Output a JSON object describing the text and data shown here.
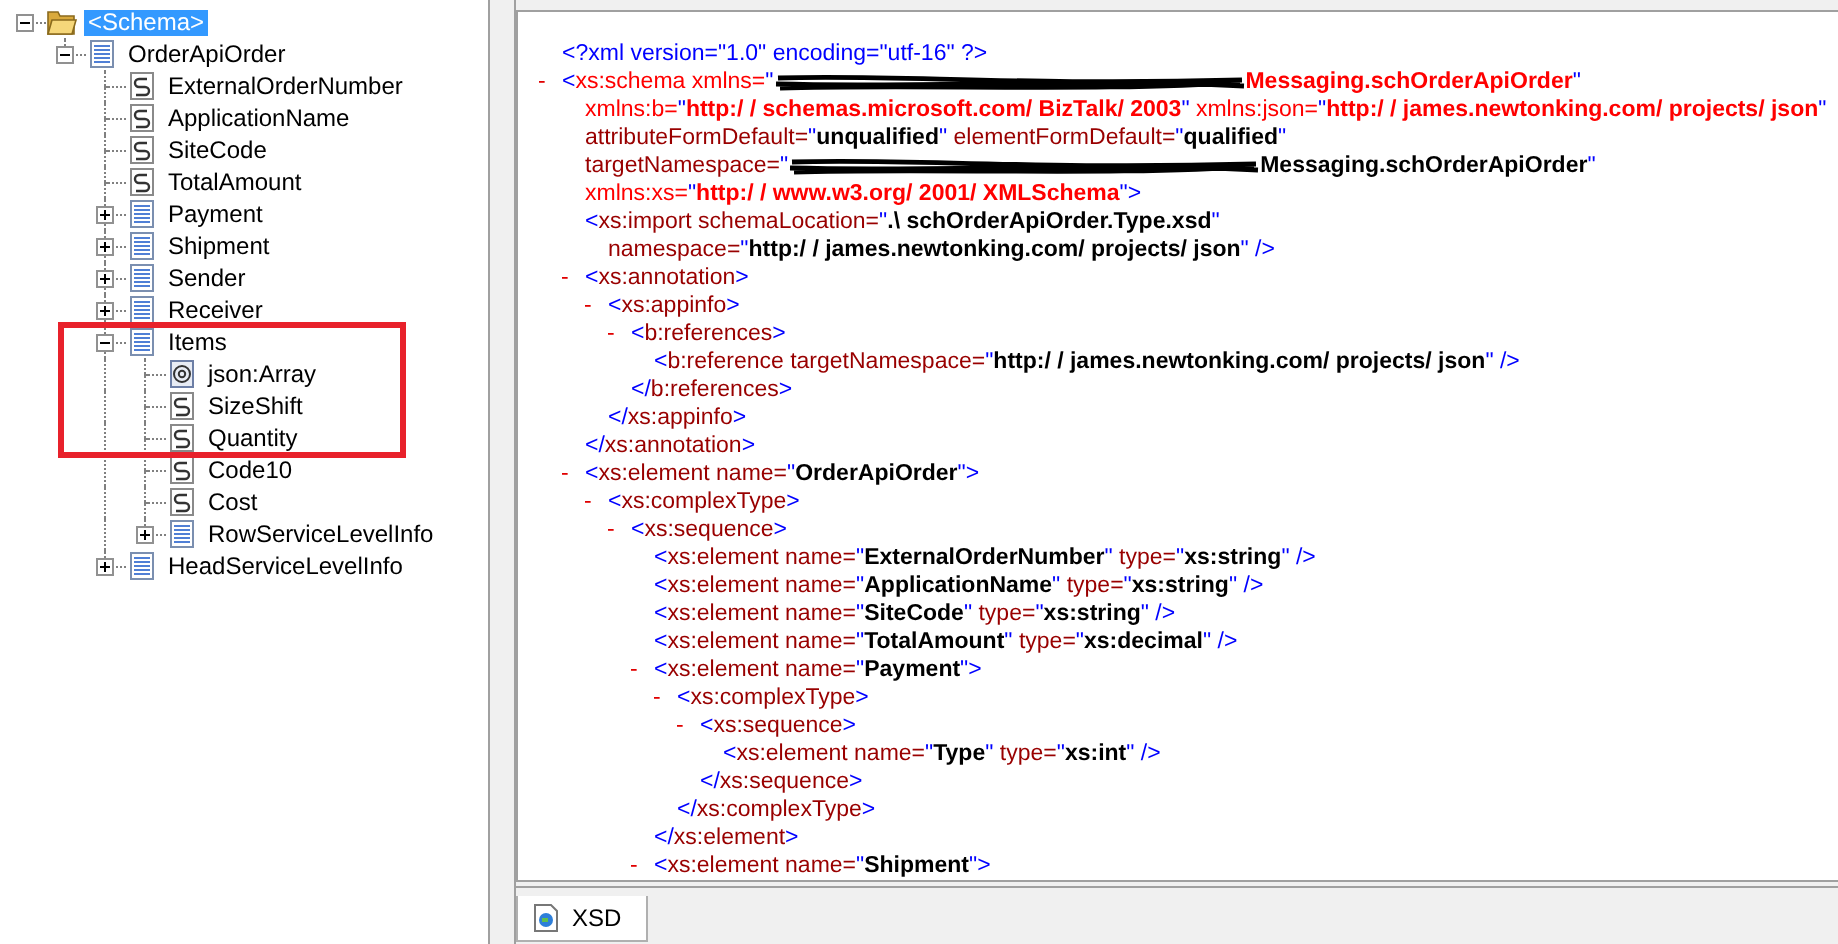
{
  "schema_tree": {
    "nodes": [
      {
        "label": "<Schema>",
        "kind": "folder",
        "expanded": true,
        "selected": true,
        "children": [
          {
            "label": "OrderApiOrder",
            "kind": "record",
            "expanded": true,
            "selected": false,
            "children": [
              {
                "label": "ExternalOrderNumber",
                "kind": "field",
                "selected": false
              },
              {
                "label": "ApplicationName",
                "kind": "field",
                "selected": false
              },
              {
                "label": "SiteCode",
                "kind": "field",
                "selected": false
              },
              {
                "label": "TotalAmount",
                "kind": "field",
                "selected": false
              },
              {
                "label": "Payment",
                "kind": "record",
                "expanded": false,
                "selected": false
              },
              {
                "label": "Shipment",
                "kind": "record",
                "expanded": false,
                "selected": false
              },
              {
                "label": "Sender",
                "kind": "record",
                "expanded": false,
                "selected": false
              },
              {
                "label": "Receiver",
                "kind": "record",
                "expanded": false,
                "selected": false
              },
              {
                "label": "Items",
                "kind": "record",
                "expanded": true,
                "selected": false,
                "children": [
                  {
                    "label": "json:Array",
                    "kind": "attribute",
                    "selected": false
                  },
                  {
                    "label": "SizeShift",
                    "kind": "field",
                    "selected": false
                  },
                  {
                    "label": "Quantity",
                    "kind": "field",
                    "selected": false
                  },
                  {
                    "label": "Code10",
                    "kind": "field",
                    "selected": false
                  },
                  {
                    "label": "Cost",
                    "kind": "field",
                    "selected": false
                  },
                  {
                    "label": "RowServiceLevelInfo",
                    "kind": "record",
                    "expanded": false,
                    "selected": false
                  }
                ]
              },
              {
                "label": "HeadServiceLevelInfo",
                "kind": "record",
                "expanded": false,
                "selected": false
              }
            ]
          }
        ]
      }
    ]
  },
  "xml_view": {
    "nodes": [
      {
        "lines": [
          [
            {
              "kind": "punct",
              "t": "<?xml version=\"1.0\" encoding=\"utf-16\" ?>"
            }
          ]
        ]
      },
      {
        "toggle": "-",
        "lines": [
          [
            {
              "kind": "punct",
              "t": "<"
            },
            {
              "kind": "namespace",
              "t": "xs:schema xmlns="
            },
            {
              "kind": "punct",
              "t": "\""
            },
            {
              "kind": "redacted"
            },
            {
              "kind": "namespace_value",
              "t": "Messaging.schOrderApiOrder"
            },
            {
              "kind": "punct",
              "t": "\""
            }
          ],
          [
            {
              "kind": "namespace",
              "t": "xmlns:b="
            },
            {
              "kind": "punct",
              "t": "\""
            },
            {
              "kind": "namespace_value",
              "t": "http:/ / schemas.microsoft.com/ BizTalk/ 2003"
            },
            {
              "kind": "punct",
              "t": "\""
            },
            {
              "kind": "namespace",
              "t": " xmlns:json="
            },
            {
              "kind": "punct",
              "t": "\""
            },
            {
              "kind": "namespace_value",
              "t": "http:/ / james.newtonking.com/ projects/ json"
            },
            {
              "kind": "punct",
              "t": "\""
            }
          ],
          [
            {
              "kind": "name",
              "t": "attributeFormDefault="
            },
            {
              "kind": "punct",
              "t": "\""
            },
            {
              "kind": "value",
              "t": "unqualified"
            },
            {
              "kind": "punct",
              "t": "\""
            },
            {
              "kind": "name",
              "t": " elementFormDefault="
            },
            {
              "kind": "punct",
              "t": "\""
            },
            {
              "kind": "value",
              "t": "qualified"
            },
            {
              "kind": "punct",
              "t": "\""
            }
          ],
          [
            {
              "kind": "name",
              "t": "targetNamespace="
            },
            {
              "kind": "punct",
              "t": "\""
            },
            {
              "kind": "redacted"
            },
            {
              "kind": "value",
              "t": "Messaging.schOrderApiOrder"
            },
            {
              "kind": "punct",
              "t": "\""
            }
          ],
          [
            {
              "kind": "namespace",
              "t": "xmlns:xs="
            },
            {
              "kind": "punct",
              "t": "\""
            },
            {
              "kind": "namespace_value",
              "t": "http:/ / www.w3.org/ 2001/ XMLSchema"
            },
            {
              "kind": "punct",
              "t": "\">"
            }
          ]
        ],
        "children": [
          {
            "lines": [
              [
                {
                  "kind": "punct",
                  "t": "<"
                },
                {
                  "kind": "name",
                  "t": "xs:import schemaLocation="
                },
                {
                  "kind": "punct",
                  "t": "\""
                },
                {
                  "kind": "value",
                  "t": ".\\ schOrderApiOrder.Type.xsd"
                },
                {
                  "kind": "punct",
                  "t": "\""
                }
              ],
              [
                {
                  "kind": "name",
                  "t": "namespace="
                },
                {
                  "kind": "punct",
                  "t": "\""
                },
                {
                  "kind": "value",
                  "t": "http:/ / james.newtonking.com/ projects/ json"
                },
                {
                  "kind": "punct",
                  "t": "\" />"
                }
              ]
            ]
          },
          {
            "toggle": "-",
            "lines": [
              [
                {
                  "kind": "punct",
                  "t": "<"
                },
                {
                  "kind": "name",
                  "t": "xs:annotation"
                },
                {
                  "kind": "punct",
                  "t": ">"
                }
              ]
            ],
            "children": [
              {
                "toggle": "-",
                "lines": [
                  [
                    {
                      "kind": "punct",
                      "t": "<"
                    },
                    {
                      "kind": "name",
                      "t": "xs:appinfo"
                    },
                    {
                      "kind": "punct",
                      "t": ">"
                    }
                  ]
                ],
                "children": [
                  {
                    "toggle": "-",
                    "lines": [
                      [
                        {
                          "kind": "punct",
                          "t": "<"
                        },
                        {
                          "kind": "name",
                          "t": "b:references"
                        },
                        {
                          "kind": "punct",
                          "t": ">"
                        }
                      ]
                    ],
                    "children": [
                      {
                        "lines": [
                          [
                            {
                              "kind": "punct",
                              "t": "<"
                            },
                            {
                              "kind": "name",
                              "t": "b:reference targetNamespace="
                            },
                            {
                              "kind": "punct",
                              "t": "\""
                            },
                            {
                              "kind": "value",
                              "t": "http:/ / james.newtonking.com/ projects/ json"
                            },
                            {
                              "kind": "punct",
                              "t": "\" />"
                            }
                          ]
                        ]
                      }
                    ],
                    "close": [
                      {
                        "kind": "punct",
                        "t": "</"
                      },
                      {
                        "kind": "name",
                        "t": "b:references"
                      },
                      {
                        "kind": "punct",
                        "t": ">"
                      }
                    ]
                  }
                ],
                "close": [
                  {
                    "kind": "punct",
                    "t": "</"
                  },
                  {
                    "kind": "name",
                    "t": "xs:appinfo"
                  },
                  {
                    "kind": "punct",
                    "t": ">"
                  }
                ]
              }
            ],
            "close": [
              {
                "kind": "punct",
                "t": "</"
              },
              {
                "kind": "name",
                "t": "xs:annotation"
              },
              {
                "kind": "punct",
                "t": ">"
              }
            ]
          },
          {
            "toggle": "-",
            "lines": [
              [
                {
                  "kind": "punct",
                  "t": "<"
                },
                {
                  "kind": "name",
                  "t": "xs:element name="
                },
                {
                  "kind": "punct",
                  "t": "\""
                },
                {
                  "kind": "value",
                  "t": "OrderApiOrder"
                },
                {
                  "kind": "punct",
                  "t": "\">"
                }
              ]
            ],
            "children": [
              {
                "toggle": "-",
                "lines": [
                  [
                    {
                      "kind": "punct",
                      "t": "<"
                    },
                    {
                      "kind": "name",
                      "t": "xs:complexType"
                    },
                    {
                      "kind": "punct",
                      "t": ">"
                    }
                  ]
                ],
                "children": [
                  {
                    "toggle": "-",
                    "lines": [
                      [
                        {
                          "kind": "punct",
                          "t": "<"
                        },
                        {
                          "kind": "name",
                          "t": "xs:sequence"
                        },
                        {
                          "kind": "punct",
                          "t": ">"
                        }
                      ]
                    ],
                    "children": [
                      {
                        "lines": [
                          [
                            {
                              "kind": "punct",
                              "t": "<"
                            },
                            {
                              "kind": "name",
                              "t": "xs:element name="
                            },
                            {
                              "kind": "punct",
                              "t": "\""
                            },
                            {
                              "kind": "value",
                              "t": "ExternalOrderNumber"
                            },
                            {
                              "kind": "punct",
                              "t": "\""
                            },
                            {
                              "kind": "name",
                              "t": " type="
                            },
                            {
                              "kind": "punct",
                              "t": "\""
                            },
                            {
                              "kind": "value",
                              "t": "xs:string"
                            },
                            {
                              "kind": "punct",
                              "t": "\" />"
                            }
                          ]
                        ]
                      },
                      {
                        "lines": [
                          [
                            {
                              "kind": "punct",
                              "t": "<"
                            },
                            {
                              "kind": "name",
                              "t": "xs:element name="
                            },
                            {
                              "kind": "punct",
                              "t": "\""
                            },
                            {
                              "kind": "value",
                              "t": "ApplicationName"
                            },
                            {
                              "kind": "punct",
                              "t": "\""
                            },
                            {
                              "kind": "name",
                              "t": " type="
                            },
                            {
                              "kind": "punct",
                              "t": "\""
                            },
                            {
                              "kind": "value",
                              "t": "xs:string"
                            },
                            {
                              "kind": "punct",
                              "t": "\" />"
                            }
                          ]
                        ]
                      },
                      {
                        "lines": [
                          [
                            {
                              "kind": "punct",
                              "t": "<"
                            },
                            {
                              "kind": "name",
                              "t": "xs:element name="
                            },
                            {
                              "kind": "punct",
                              "t": "\""
                            },
                            {
                              "kind": "value",
                              "t": "SiteCode"
                            },
                            {
                              "kind": "punct",
                              "t": "\""
                            },
                            {
                              "kind": "name",
                              "t": " type="
                            },
                            {
                              "kind": "punct",
                              "t": "\""
                            },
                            {
                              "kind": "value",
                              "t": "xs:string"
                            },
                            {
                              "kind": "punct",
                              "t": "\" />"
                            }
                          ]
                        ]
                      },
                      {
                        "lines": [
                          [
                            {
                              "kind": "punct",
                              "t": "<"
                            },
                            {
                              "kind": "name",
                              "t": "xs:element name="
                            },
                            {
                              "kind": "punct",
                              "t": "\""
                            },
                            {
                              "kind": "value",
                              "t": "TotalAmount"
                            },
                            {
                              "kind": "punct",
                              "t": "\""
                            },
                            {
                              "kind": "name",
                              "t": " type="
                            },
                            {
                              "kind": "punct",
                              "t": "\""
                            },
                            {
                              "kind": "value",
                              "t": "xs:decimal"
                            },
                            {
                              "kind": "punct",
                              "t": "\" />"
                            }
                          ]
                        ]
                      },
                      {
                        "toggle": "-",
                        "lines": [
                          [
                            {
                              "kind": "punct",
                              "t": "<"
                            },
                            {
                              "kind": "name",
                              "t": "xs:element name="
                            },
                            {
                              "kind": "punct",
                              "t": "\""
                            },
                            {
                              "kind": "value",
                              "t": "Payment"
                            },
                            {
                              "kind": "punct",
                              "t": "\">"
                            }
                          ]
                        ],
                        "children": [
                          {
                            "toggle": "-",
                            "lines": [
                              [
                                {
                                  "kind": "punct",
                                  "t": "<"
                                },
                                {
                                  "kind": "name",
                                  "t": "xs:complexType"
                                },
                                {
                                  "kind": "punct",
                                  "t": ">"
                                }
                              ]
                            ],
                            "children": [
                              {
                                "toggle": "-",
                                "lines": [
                                  [
                                    {
                                      "kind": "punct",
                                      "t": "<"
                                    },
                                    {
                                      "kind": "name",
                                      "t": "xs:sequence"
                                    },
                                    {
                                      "kind": "punct",
                                      "t": ">"
                                    }
                                  ]
                                ],
                                "children": [
                                  {
                                    "lines": [
                                      [
                                        {
                                          "kind": "punct",
                                          "t": "<"
                                        },
                                        {
                                          "kind": "name",
                                          "t": "xs:element name="
                                        },
                                        {
                                          "kind": "punct",
                                          "t": "\""
                                        },
                                        {
                                          "kind": "value",
                                          "t": "Type"
                                        },
                                        {
                                          "kind": "punct",
                                          "t": "\""
                                        },
                                        {
                                          "kind": "name",
                                          "t": " type="
                                        },
                                        {
                                          "kind": "punct",
                                          "t": "\""
                                        },
                                        {
                                          "kind": "value",
                                          "t": "xs:int"
                                        },
                                        {
                                          "kind": "punct",
                                          "t": "\" />"
                                        }
                                      ]
                                    ]
                                  }
                                ],
                                "close": [
                                  {
                                    "kind": "punct",
                                    "t": "</"
                                  },
                                  {
                                    "kind": "name",
                                    "t": "xs:sequence"
                                  },
                                  {
                                    "kind": "punct",
                                    "t": ">"
                                  }
                                ]
                              }
                            ],
                            "close": [
                              {
                                "kind": "punct",
                                "t": "</"
                              },
                              {
                                "kind": "name",
                                "t": "xs:complexType"
                              },
                              {
                                "kind": "punct",
                                "t": ">"
                              }
                            ]
                          }
                        ],
                        "close": [
                          {
                            "kind": "punct",
                            "t": "</"
                          },
                          {
                            "kind": "name",
                            "t": "xs:element"
                          },
                          {
                            "kind": "punct",
                            "t": ">"
                          }
                        ]
                      },
                      {
                        "toggle": "-",
                        "lines": [
                          [
                            {
                              "kind": "punct",
                              "t": "<"
                            },
                            {
                              "kind": "name",
                              "t": "xs:element name="
                            },
                            {
                              "kind": "punct",
                              "t": "\""
                            },
                            {
                              "kind": "value",
                              "t": "Shipment"
                            },
                            {
                              "kind": "punct",
                              "t": "\">"
                            }
                          ]
                        ]
                      }
                    ]
                  }
                ]
              }
            ]
          }
        ]
      }
    ]
  },
  "tabs": [
    {
      "label": "XSD",
      "selected": true
    }
  ]
}
